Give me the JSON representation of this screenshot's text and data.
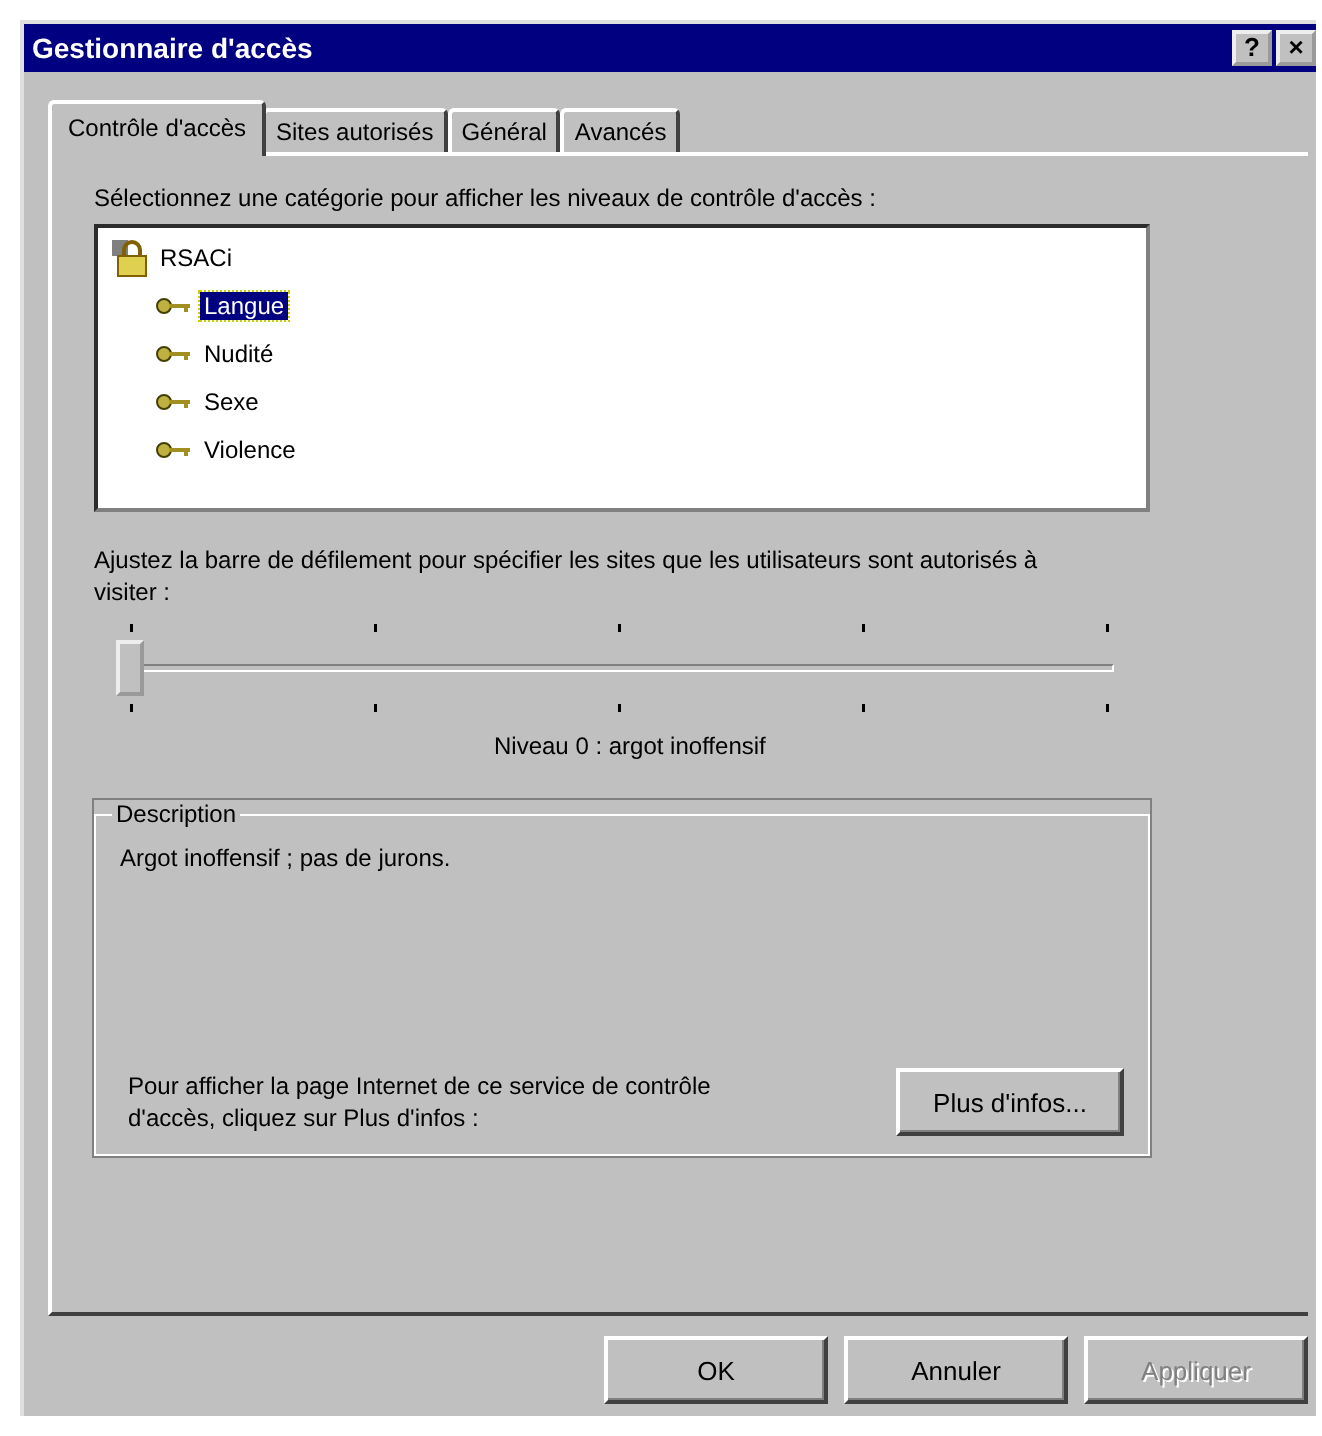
{
  "window": {
    "title": "Gestionnaire d'accès",
    "title_buttons": [
      "?",
      "×"
    ]
  },
  "tabs": [
    {
      "label": "Contrôle d'accès",
      "selected": true
    },
    {
      "label": "Sites autorisés",
      "selected": false
    },
    {
      "label": "Général",
      "selected": false
    },
    {
      "label": "Avancés",
      "selected": false
    }
  ],
  "category_label": "Sélectionnez une catégorie pour afficher les niveaux de contrôle d'accès :",
  "tree": {
    "label": "RSACi",
    "children": [
      {
        "label": "Langue",
        "selected": true
      },
      {
        "label": "Nudité",
        "selected": false
      },
      {
        "label": "Sexe",
        "selected": false
      },
      {
        "label": "Violence",
        "selected": false
      }
    ]
  },
  "slider_label": "Ajustez la barre de défilement pour spécifier les sites que les utilisateurs sont autorisés à visiter :",
  "slider": {
    "level": 0
  },
  "level_text": "Niveau 0 : argot inoffensif",
  "description": {
    "title": "Description",
    "text": "Argot inoffensif ; pas de jurons.",
    "info_text": "Pour afficher la page Internet de ce service de contrôle d'accès, cliquez sur Plus d'infos :",
    "info_button": "Plus d'infos..."
  },
  "buttons": [
    {
      "label": "OK",
      "disabled": false
    },
    {
      "label": "Annuler",
      "disabled": false
    },
    {
      "label": "Appliquer",
      "disabled": true
    }
  ]
}
